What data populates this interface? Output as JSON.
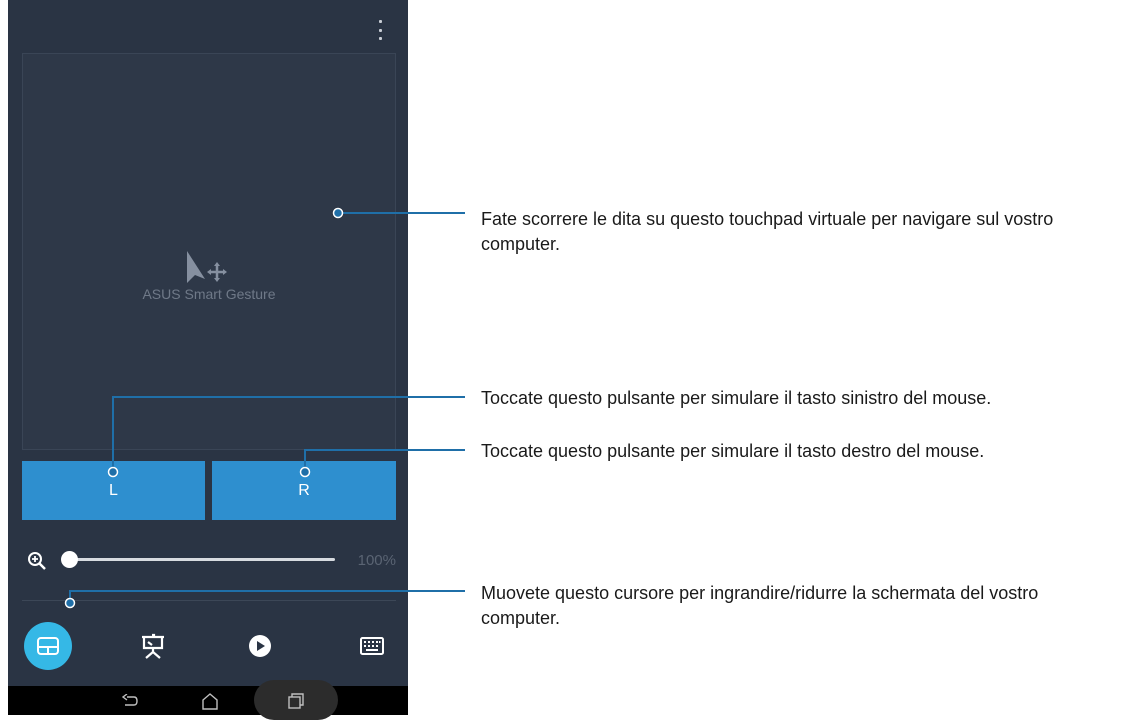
{
  "app": {
    "menu_icon": "overflow-menu-icon",
    "touchpad_label": "ASUS Smart Gesture",
    "touchpad_icon": "pointer-move-icon",
    "left_button_label": "L",
    "right_button_label": "R",
    "zoom": {
      "icon": "zoom-in-icon",
      "value_text": "100%",
      "level_fraction": 0.0
    },
    "tabs": [
      {
        "name": "touchpad-tab",
        "icon": "touchpad-icon",
        "active": true
      },
      {
        "name": "presentation-tab",
        "icon": "presentation-icon",
        "active": false
      },
      {
        "name": "media-tab",
        "icon": "play-icon",
        "active": false
      },
      {
        "name": "keyboard-tab",
        "icon": "keyboard-icon",
        "active": false
      }
    ],
    "nav": {
      "back_icon": "back-icon",
      "home_icon": "home-icon",
      "recent_icon": "recent-apps-icon"
    }
  },
  "annotations": {
    "touchpad": "Fate scorrere le dita su questo touchpad virtuale per navigare sul vostro computer.",
    "left_button": "Toccate questo pulsante per simulare il tasto sinistro del mouse.",
    "right_button": "Toccate questo pulsante per simulare il tasto destro del mouse.",
    "slider": "Muovete questo cursore per ingrandire/ridurre la schermata del vostro computer."
  },
  "colors": {
    "background": "#2a3444",
    "button": "#2e8fcf",
    "active_tab": "#35b8e6",
    "callout_line": "#1f6fa8"
  }
}
